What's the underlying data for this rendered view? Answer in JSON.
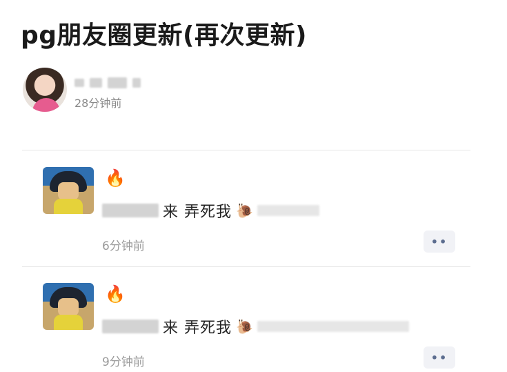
{
  "title": "pg朋友圈更新(再次更新)",
  "author": {
    "time": "28分钟前"
  },
  "comments": [
    {
      "emoji": "🔥",
      "text": "来 弄死我",
      "emoji2": "🐌",
      "time": "6分钟前",
      "more": "••"
    },
    {
      "emoji": "🔥",
      "text": "来 弄死我",
      "emoji2": "🐌",
      "time": "9分钟前",
      "more": "••"
    }
  ]
}
